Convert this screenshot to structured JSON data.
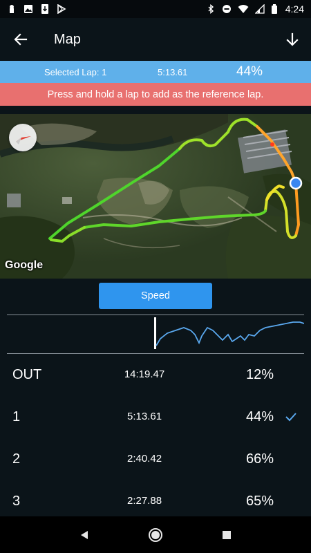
{
  "status_bar": {
    "time": "4:24"
  },
  "app_bar": {
    "title": "Map"
  },
  "selected_lap": {
    "label": "Selected Lap: 1",
    "time": "5:13.61",
    "percent": "44%"
  },
  "hint": "Press and hold a lap to add as the reference lap.",
  "map": {
    "attribution": "Google"
  },
  "chart_button": {
    "label": "Speed"
  },
  "laps": [
    {
      "name": "OUT",
      "time": "14:19.47",
      "percent": "12%",
      "selected": false
    },
    {
      "name": "1",
      "time": "5:13.61",
      "percent": "44%",
      "selected": true
    },
    {
      "name": "2",
      "time": "2:40.42",
      "percent": "66%",
      "selected": false
    },
    {
      "name": "3",
      "time": "2:27.88",
      "percent": "65%",
      "selected": false
    }
  ],
  "colors": {
    "accent": "#2f95ee",
    "banner_blue": "#5fb0ea",
    "banner_red": "#e8706f",
    "background": "#0b1419",
    "speed_line": "#5aa8ee"
  }
}
